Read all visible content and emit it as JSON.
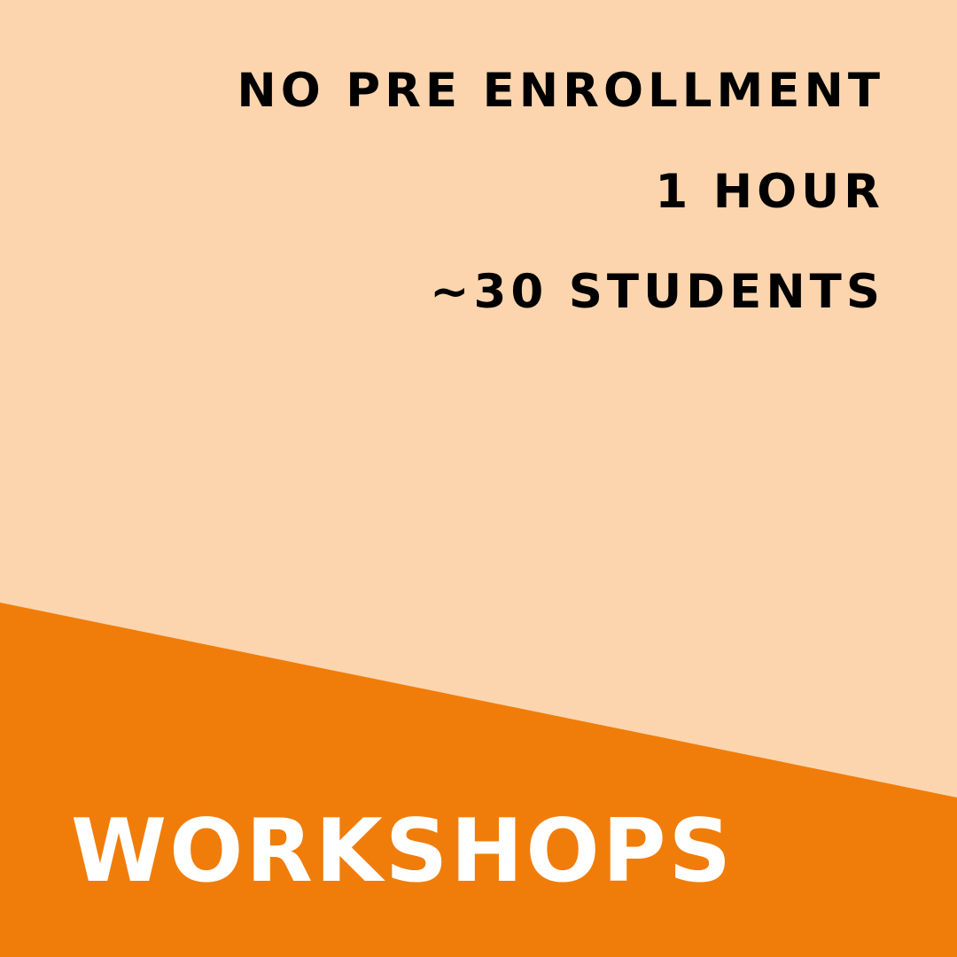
{
  "colors": {
    "background": "#FCD5AE",
    "accent": "#F07D0A",
    "info_text": "#000000",
    "headline_text": "#FFFFFF"
  },
  "details": [
    "NO PRE ENROLLMENT",
    "1 HOUR",
    "~30 STUDENTS"
  ],
  "headline": "WORKSHOPS"
}
